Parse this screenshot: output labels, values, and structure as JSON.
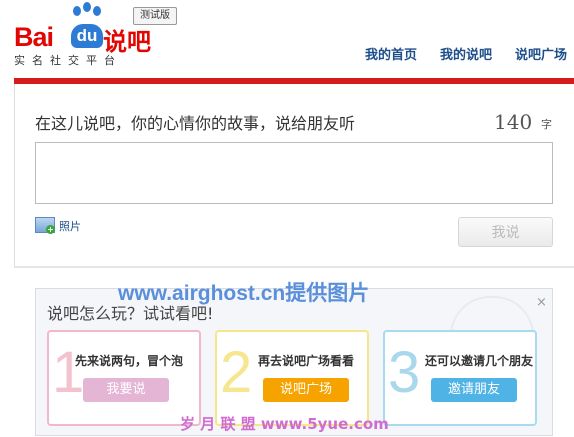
{
  "header": {
    "logo": {
      "bai": "Bai",
      "du": "du",
      "shuoba": "说吧",
      "subtitle": "实名社交平台"
    },
    "beta_badge": "测试版",
    "nav": [
      "我的首页",
      "我的说吧",
      "说吧广场"
    ]
  },
  "composer": {
    "prompt": "在这儿说吧，你的心情你的故事，说给朋友听",
    "char_count": "140",
    "char_unit": "字",
    "textbox_value": "",
    "photo_label": "照片",
    "post_button": "我说"
  },
  "guide": {
    "title": "说吧怎么玩？试试看吧!",
    "close": "×",
    "steps": [
      {
        "number": "1",
        "text": "先来说两句，冒个泡",
        "button": "我要说",
        "border_color": "#f0b8c8",
        "number_color": "#f3c2cf",
        "button_color": "#e5b5d6"
      },
      {
        "number": "2",
        "text": "再去说吧广场看看",
        "button": "说吧广场",
        "border_color": "#f5e68a",
        "number_color": "#f6e690",
        "button_color": "#f6a300"
      },
      {
        "number": "3",
        "text": "还可以邀请几个朋友",
        "button": "邀请朋友",
        "border_color": "#a8dbef",
        "number_color": "#a9d8ec",
        "button_color": "#4fb3e5"
      }
    ]
  },
  "watermarks": {
    "top": "www.airghost.cn提供图片",
    "bottom": "岁 月 联 盟  www.5yue.com"
  },
  "colors": {
    "brand_red": "#d71a1b",
    "brand_blue": "#2e7bd6",
    "nav": "#1d4e8a"
  }
}
